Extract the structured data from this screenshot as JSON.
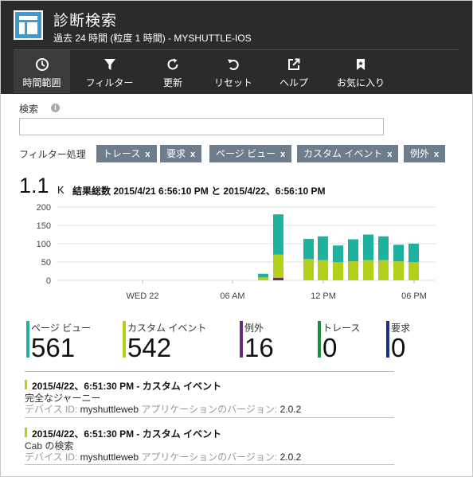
{
  "header": {
    "title": "診断検索",
    "subtitle": "過去 24 時間 (粒度 1 時間) - MYSHUTTLE-IOS"
  },
  "toolbar": [
    {
      "label": "時間範囲",
      "icon": "clock-icon"
    },
    {
      "label": "フィルター",
      "icon": "filter-icon"
    },
    {
      "label": "更新",
      "icon": "refresh-icon"
    },
    {
      "label": "リセット",
      "icon": "reset-icon"
    },
    {
      "label": "ヘルプ",
      "icon": "external-link-icon"
    },
    {
      "label": "お気に入り",
      "icon": "bookmark-icon"
    }
  ],
  "search": {
    "label": "検索",
    "value": "",
    "placeholder": ""
  },
  "filters": {
    "label": "フィルター処理",
    "chips": [
      "トレース",
      "要求",
      "ページ ビュー",
      "カスタム イベント",
      "例外"
    ],
    "remove_glyph": "x"
  },
  "summary": {
    "count": "1.1",
    "unit": "K",
    "text": "結果総数 2015/4/21 6:56:10 PM と 2015/4/22、6:56:10 PM"
  },
  "chart_data": {
    "type": "bar",
    "stacked": true,
    "x_tick_labels": [
      "WED 22",
      "06 AM",
      "12 PM",
      "06 PM"
    ],
    "y_tick_labels": [
      "200",
      "150",
      "100",
      "50",
      "0"
    ],
    "ylim": [
      0,
      200
    ],
    "grid": true,
    "series": [
      {
        "color": "#b4cf1a",
        "values": [
          0,
          0,
          0,
          0,
          0,
          0,
          0,
          0,
          0,
          0,
          0,
          0,
          0,
          0,
          0,
          0,
          0,
          0,
          0,
          0,
          0,
          0,
          0,
          0,
          0,
          0,
          0,
          0,
          0,
          0,
          0,
          0,
          0,
          0,
          0,
          0,
          0,
          0,
          0,
          0,
          0,
          0,
          0,
          0,
          0,
          0,
          0,
          0,
          0,
          0,
          0,
          0,
          0,
          0,
          0,
          0,
          0,
          0,
          0,
          0,
          0,
          0,
          0,
          8,
          0,
          0,
          70,
          0,
          0,
          0,
          0,
          58,
          0,
          0,
          55,
          0,
          0,
          0,
          50,
          0,
          0,
          52,
          0,
          0,
          0,
          55,
          0,
          0,
          55,
          0,
          0,
          0,
          52,
          0,
          0,
          0
        ]
      },
      {
        "color": "#6b2a7f",
        "values": [
          0,
          0,
          0,
          0,
          0,
          0,
          0,
          0,
          0,
          0,
          0,
          0,
          0,
          0,
          0,
          0,
          0,
          0,
          0,
          0,
          0,
          0,
          0,
          0,
          0,
          0,
          0,
          0,
          0,
          0,
          0,
          0,
          0,
          0,
          0,
          0,
          0,
          0,
          0,
          0,
          0,
          0,
          0,
          0,
          0,
          0,
          0,
          0,
          0,
          0,
          0,
          0,
          0,
          0,
          0,
          0,
          0,
          0,
          0,
          0,
          0,
          0,
          0,
          0,
          0,
          0,
          7,
          0,
          0,
          0,
          0,
          0,
          0,
          0,
          0,
          0,
          0,
          0,
          0,
          0,
          0,
          0,
          0,
          0,
          0,
          0,
          0,
          0,
          0,
          0,
          0,
          0,
          0,
          0,
          0,
          0
        ]
      },
      {
        "color": "#1fb1a0",
        "values": [
          0,
          0,
          0,
          0,
          0,
          0,
          0,
          0,
          0,
          0,
          0,
          0,
          0,
          0,
          0,
          0,
          0,
          0,
          0,
          0,
          0,
          0,
          0,
          0,
          0,
          0,
          0,
          0,
          0,
          0,
          0,
          0,
          0,
          0,
          0,
          0,
          0,
          0,
          0,
          0,
          0,
          0,
          0,
          0,
          0,
          0,
          0,
          0,
          0,
          0,
          0,
          0,
          0,
          0,
          0,
          0,
          0,
          0,
          0,
          0,
          0,
          0,
          0,
          10,
          0,
          0,
          110,
          0,
          0,
          0,
          0,
          55,
          0,
          0,
          65,
          0,
          0,
          0,
          45,
          0,
          0,
          60,
          0,
          0,
          0,
          70,
          0,
          0,
          65,
          0,
          0,
          0,
          45,
          0,
          0,
          0
        ]
      }
    ]
  },
  "bars": [
    {
      "x": "~03 AM",
      "pageview": 0,
      "custom": 8,
      "exception": 0,
      "trace": 10
    },
    {
      "x": "~04 AM",
      "pageview": 0,
      "custom": 70,
      "exception": 7,
      "trace": 110
    },
    {
      "x": "~06 AM",
      "pageview": 0,
      "custom": 58,
      "exception": 0,
      "trace": 55
    },
    {
      "x": "~07 AM",
      "pageview": 0,
      "custom": 55,
      "exception": 0,
      "trace": 65
    },
    {
      "x": "~08 AM",
      "pageview": 0,
      "custom": 50,
      "exception": 0,
      "trace": 45
    },
    {
      "x": "~09 AM",
      "pageview": 0,
      "custom": 52,
      "exception": 0,
      "trace": 60
    },
    {
      "x": "~10 AM",
      "pageview": 0,
      "custom": 55,
      "exception": 0,
      "trace": 70
    },
    {
      "x": "~11 AM",
      "pageview": 0,
      "custom": 55,
      "exception": 0,
      "trace": 65
    },
    {
      "x": "~12 PM",
      "pageview": 0,
      "custom": 52,
      "exception": 0,
      "trace": 45
    }
  ],
  "stats": [
    {
      "label": "ページ ビュー",
      "value": "561",
      "color": "#1fb1a0"
    },
    {
      "label": "カスタム イベント",
      "value": "542",
      "color": "#b4cf1a"
    },
    {
      "label": "例外",
      "value": "16",
      "color": "#6b2a7f"
    },
    {
      "label": "トレース",
      "value": "0",
      "color": "#1c8e3e"
    },
    {
      "label": "要求",
      "value": "0",
      "color": "#1d2f8a"
    }
  ],
  "events": [
    {
      "title": "2015/4/22、6:51:30 PM - カスタム イベント",
      "name": "完全なジャーニー",
      "meta_device_label": "デバイス ID:",
      "meta_device": "myshuttleweb",
      "meta_version_label": "アプリケーションのバージョン:",
      "meta_version": "2.0.2"
    },
    {
      "title": "2015/4/22、6:51:30 PM - カスタム イベント",
      "name": "Cab の検索",
      "meta_device_label": "デバイス ID:",
      "meta_device": "myshuttleweb",
      "meta_version_label": "アプリケーションのバージョン:",
      "meta_version": "2.0.2"
    }
  ],
  "colors": {
    "header_bg": "#2b2b2b",
    "accent": "#3c9bd5",
    "chip_bg": "#6d7d8c"
  }
}
